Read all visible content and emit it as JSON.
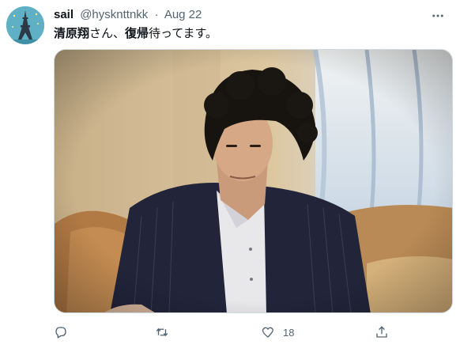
{
  "tweet": {
    "author": {
      "display_name": "sail",
      "handle": "@hysknttnkk",
      "separator": "·",
      "date": "Aug 22"
    },
    "text": {
      "name": "清原翔",
      "part1": "さん、",
      "bold_word": "復帰",
      "part2": "待ってます。"
    },
    "actions": {
      "like_count": "18"
    }
  },
  "icons": {
    "more": "more-icon",
    "reply": "reply-icon",
    "retweet": "retweet-icon",
    "like": "heart-icon",
    "share": "share-icon"
  },
  "colors": {
    "text_primary": "#0f1419",
    "text_secondary": "#536471",
    "avatar_bg": "#5fb0c4"
  }
}
